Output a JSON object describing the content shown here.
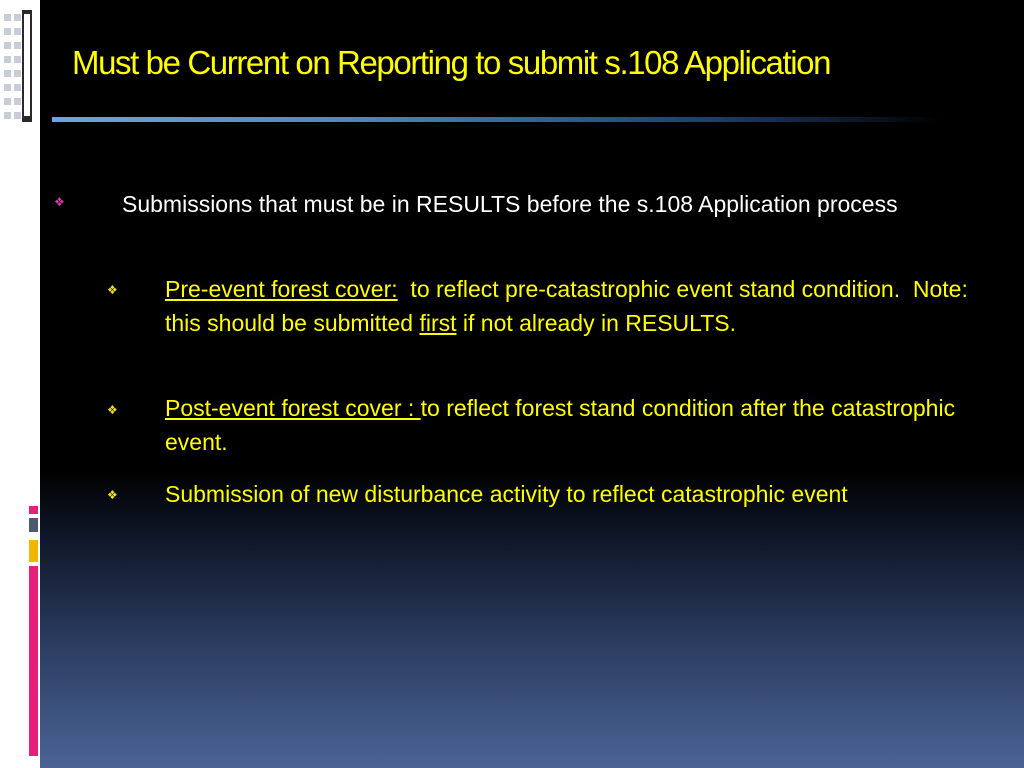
{
  "slide": {
    "title": "Must be Current on Reporting to submit s.108 Application",
    "bullet_glyph": "❖",
    "level1": {
      "text": "Submissions that must be in RESULTS before the s.108 Application process"
    },
    "items": [
      {
        "lead": "Pre-event forest cover:",
        "text_a": "  to reflect pre-catastrophic event stand condition.  Note: this should be submitted ",
        "emph": "first",
        "text_b": " if not already in RESULTS."
      },
      {
        "lead": "Post-event forest cover : ",
        "text_a": "to reflect forest stand condition after the catastrophic event."
      },
      {
        "text_a": "Submission of new disturbance activity to reflect catastrophic event"
      }
    ]
  },
  "colors": {
    "title": "#ffff00",
    "body_level1": "#ffffff",
    "body_level2": "#ffff00",
    "bullet_level1": "#d63aa8",
    "bullet_level2": "#f2e21a",
    "accent_pink": "#e91e7a",
    "accent_gold": "#f2b705",
    "accent_slate": "#4d5b70"
  }
}
